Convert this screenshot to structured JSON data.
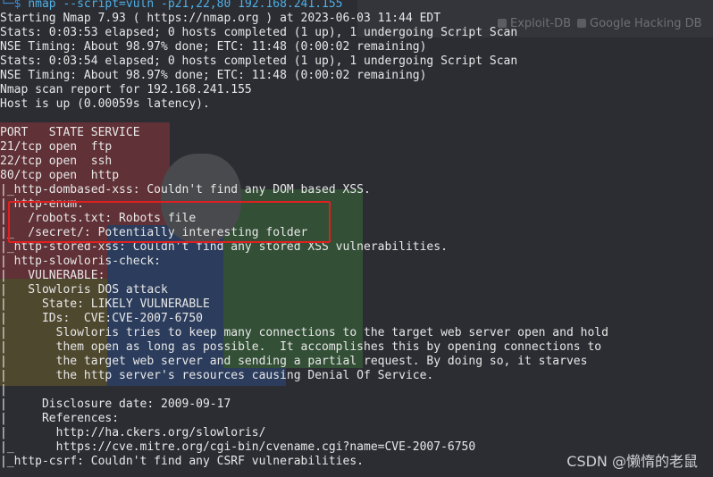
{
  "background_tabs": [
    {
      "label": "Exploit-DB"
    },
    {
      "label": "Google Hacking DB"
    }
  ],
  "terminal": {
    "prompt_glyph": "└─$",
    "command": "nmap --script=vuln -p21,22,80 192.168.241.155",
    "lines": [
      "Starting Nmap 7.93 ( https://nmap.org ) at 2023-06-03 11:44 EDT",
      "Stats: 0:03:53 elapsed; 0 hosts completed (1 up), 1 undergoing Script Scan",
      "NSE Timing: About 98.97% done; ETC: 11:48 (0:00:02 remaining)",
      "Stats: 0:03:54 elapsed; 0 hosts completed (1 up), 1 undergoing Script Scan",
      "NSE Timing: About 98.97% done; ETC: 11:48 (0:00:02 remaining)",
      "Nmap scan report for 192.168.241.155",
      "Host is up (0.00059s latency).",
      "",
      "PORT   STATE SERVICE",
      "21/tcp open  ftp",
      "22/tcp open  ssh",
      "80/tcp open  http",
      "|_http-dombased-xss: Couldn't find any DOM based XSS.",
      "| http-enum:",
      "|   /robots.txt: Robots file",
      "|_  /secret/: Potentially interesting folder",
      "|_http-stored-xss: Couldn't find any stored XSS vulnerabilities.",
      "| http-slowloris-check:",
      "|   VULNERABLE:",
      "|   Slowloris DOS attack",
      "|     State: LIKELY VULNERABLE",
      "|     IDs:  CVE:CVE-2007-6750",
      "|       Slowloris tries to keep many connections to the target web server open and hold",
      "|       them open as long as possible.  It accomplishes this by opening connections to",
      "|       the target web server and sending a partial request. By doing so, it starves",
      "|       the http server's resources causing Denial Of Service.",
      "|",
      "|     Disclosure date: 2009-09-17",
      "|     References:",
      "|       http://ha.ckers.org/slowloris/",
      "|_      https://cve.mitre.org/cgi-bin/cvename.cgi?name=CVE-2007-6750",
      "|_http-csrf: Couldn't find any CSRF vulnerabilities."
    ]
  },
  "watermark": "CSDN @懒惰的老鼠",
  "colors": {
    "background": "#2b2d33",
    "text": "#e8e8e8",
    "prompt": "#4fb0e6",
    "highlight_border": "#e02020"
  }
}
